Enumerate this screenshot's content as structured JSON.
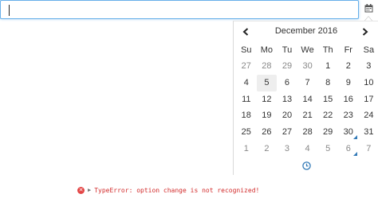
{
  "input": {
    "value": ""
  },
  "calendar": {
    "title": "December 2016",
    "weekdays": [
      "Su",
      "Mo",
      "Tu",
      "We",
      "Th",
      "Fr",
      "Sa"
    ],
    "weeks": [
      [
        {
          "d": "27",
          "c": "old"
        },
        {
          "d": "28",
          "c": "old"
        },
        {
          "d": "29",
          "c": "old"
        },
        {
          "d": "30",
          "c": "old"
        },
        {
          "d": "1",
          "c": ""
        },
        {
          "d": "2",
          "c": ""
        },
        {
          "d": "3",
          "c": ""
        }
      ],
      [
        {
          "d": "4",
          "c": ""
        },
        {
          "d": "5",
          "c": "today"
        },
        {
          "d": "6",
          "c": ""
        },
        {
          "d": "7",
          "c": ""
        },
        {
          "d": "8",
          "c": ""
        },
        {
          "d": "9",
          "c": ""
        },
        {
          "d": "10",
          "c": ""
        }
      ],
      [
        {
          "d": "11",
          "c": ""
        },
        {
          "d": "12",
          "c": ""
        },
        {
          "d": "13",
          "c": ""
        },
        {
          "d": "14",
          "c": ""
        },
        {
          "d": "15",
          "c": ""
        },
        {
          "d": "16",
          "c": ""
        },
        {
          "d": "17",
          "c": ""
        }
      ],
      [
        {
          "d": "18",
          "c": ""
        },
        {
          "d": "19",
          "c": ""
        },
        {
          "d": "20",
          "c": ""
        },
        {
          "d": "21",
          "c": ""
        },
        {
          "d": "22",
          "c": ""
        },
        {
          "d": "23",
          "c": ""
        },
        {
          "d": "24",
          "c": ""
        }
      ],
      [
        {
          "d": "25",
          "c": ""
        },
        {
          "d": "26",
          "c": ""
        },
        {
          "d": "27",
          "c": ""
        },
        {
          "d": "28",
          "c": ""
        },
        {
          "d": "29",
          "c": ""
        },
        {
          "d": "30",
          "c": "marked"
        },
        {
          "d": "31",
          "c": ""
        }
      ],
      [
        {
          "d": "1",
          "c": "new"
        },
        {
          "d": "2",
          "c": "new"
        },
        {
          "d": "3",
          "c": "new"
        },
        {
          "d": "4",
          "c": "new"
        },
        {
          "d": "5",
          "c": "new"
        },
        {
          "d": "6",
          "c": "new marked"
        },
        {
          "d": "7",
          "c": "new"
        }
      ]
    ],
    "accent": "#337ab7",
    "today_bg": "#eeeeee"
  },
  "console": {
    "message": "TypeError: option change is not recognized!",
    "error_color": "#d22a2a"
  },
  "icons": {
    "addon": "calendar-icon",
    "prev": "chevron-left-icon",
    "next": "chevron-right-icon",
    "footer": "clock-icon",
    "error": "error-icon"
  }
}
